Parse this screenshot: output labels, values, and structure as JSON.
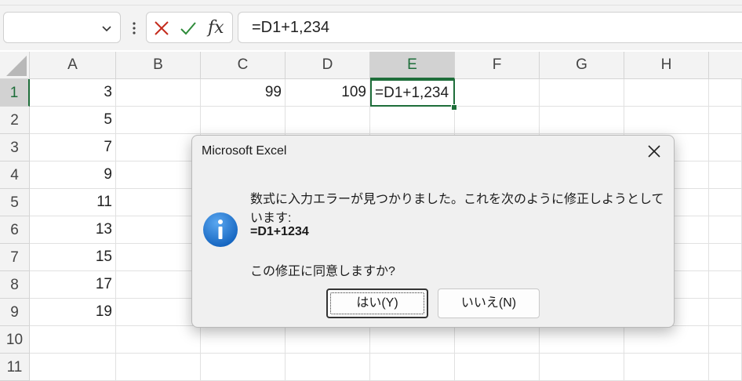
{
  "formula_bar": {
    "name_box_value": "",
    "formula": "=D1+1,234",
    "fx_label": "fx"
  },
  "sheet": {
    "columns": [
      "A",
      "B",
      "C",
      "D",
      "E",
      "F",
      "G",
      "H"
    ],
    "rows": [
      "1",
      "2",
      "3",
      "4",
      "5",
      "6",
      "7",
      "8",
      "9",
      "10",
      "11"
    ],
    "selected_column": "E",
    "selected_row": "1",
    "cells": {
      "A1": "3",
      "A2": "5",
      "A3": "7",
      "A4": "9",
      "A5": "11",
      "A6": "13",
      "A7": "15",
      "A8": "17",
      "A9": "19",
      "C1": "99",
      "D1": "109",
      "E1": "=D1+1,234"
    }
  },
  "dialog": {
    "title": "Microsoft Excel",
    "message_line1": "数式に入力エラーが見つかりました。これを次のように修正しようとしています:",
    "suggested_formula": "=D1+1234",
    "question": "この修正に同意しますか?",
    "yes_button": "はい(Y)",
    "no_button": "いいえ(N)"
  },
  "colors": {
    "excel_green": "#1e6e3a",
    "cancel_red": "#c42b1c",
    "enter_green": "#2e8b3a",
    "info_blue": "#1a73d6"
  }
}
